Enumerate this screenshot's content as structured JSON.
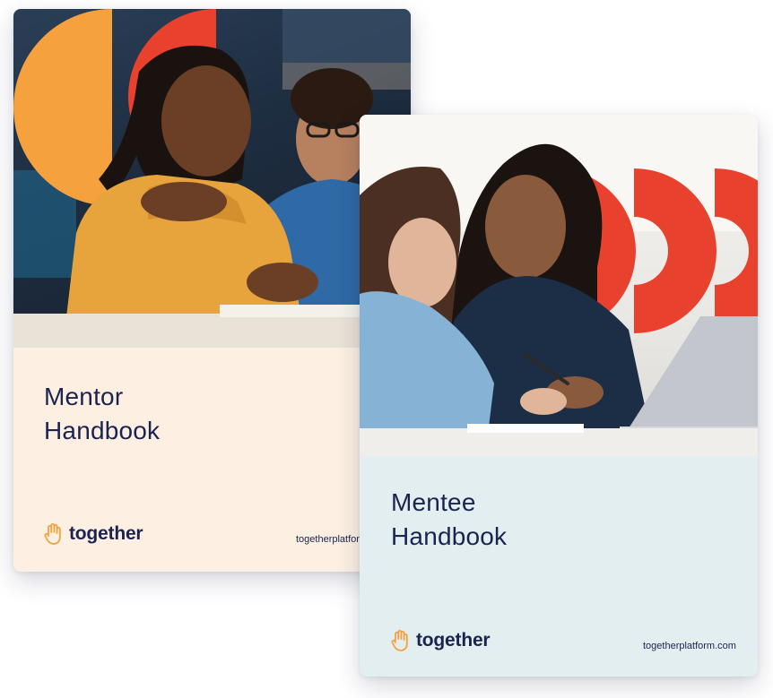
{
  "colors": {
    "navy": "#1b2350",
    "orange": "#f5a13e",
    "red": "#e8412e",
    "mentor_background": "#fdf0e2",
    "mentee_background": "#e3eef0"
  },
  "mentor_handbook": {
    "title_line_1": "Mentor",
    "title_line_2": "Handbook",
    "brand_icon": "raised-hand-icon",
    "brand_name": "together",
    "url": "togetherplatform.com"
  },
  "mentee_handbook": {
    "title_line_1": "Mentee",
    "title_line_2": "Handbook",
    "brand_icon": "raised-hand-icon",
    "brand_name": "together",
    "url": "togetherplatform.com"
  }
}
